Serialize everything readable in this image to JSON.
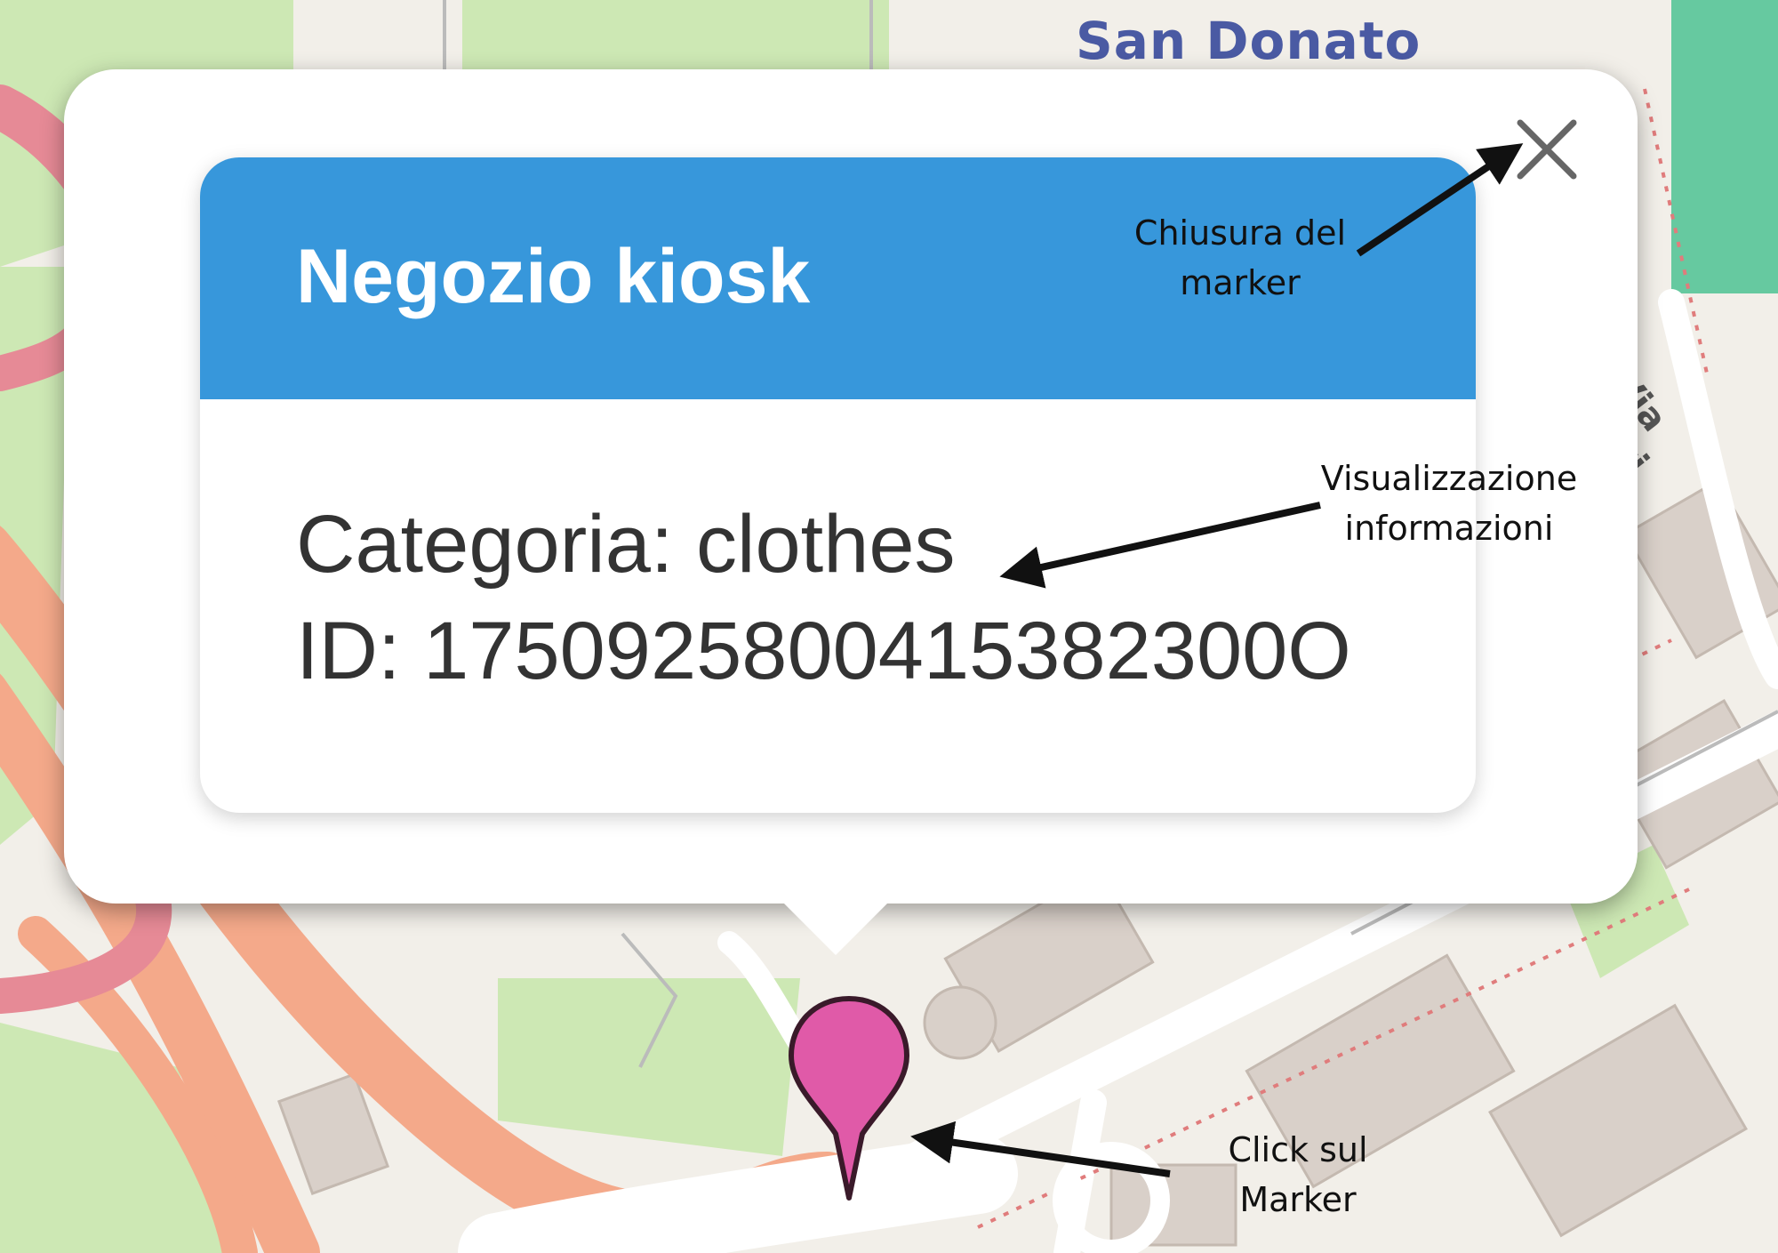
{
  "map": {
    "district_label": "San Donato",
    "street_label": "Via Cavi"
  },
  "popup": {
    "title": "Negozio kiosk",
    "category_line": "Categoria: clothes",
    "id_line": "ID: 1750925800415382300O"
  },
  "annotations": {
    "close_line1": "Chiusura del",
    "close_line2": "marker",
    "info_line1": "Visualizzazione",
    "info_line2": "informazioni",
    "marker_line1": "Click sul",
    "marker_line2": "Marker"
  },
  "icons": {
    "close": "close-icon",
    "marker": "map-pin-icon"
  },
  "colors": {
    "header": "#3797db",
    "marker": "#e05aa8"
  }
}
